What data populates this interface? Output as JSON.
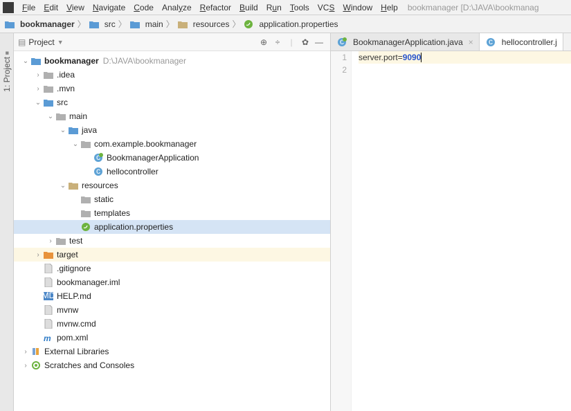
{
  "menu": {
    "items": [
      "File",
      "Edit",
      "View",
      "Navigate",
      "Code",
      "Analyze",
      "Refactor",
      "Build",
      "Run",
      "Tools",
      "VCS",
      "Window",
      "Help"
    ],
    "underlines": [
      0,
      0,
      0,
      0,
      0,
      4,
      0,
      0,
      1,
      0,
      2,
      0,
      0
    ],
    "title_path": "bookmanager [D:\\JAVA\\bookmanag"
  },
  "breadcrumbs": [
    {
      "label": "bookmanager",
      "icon": "folder-blue",
      "bold": true
    },
    {
      "label": "src",
      "icon": "folder-blue"
    },
    {
      "label": "main",
      "icon": "folder-blue"
    },
    {
      "label": "resources",
      "icon": "folder-tan"
    },
    {
      "label": "application.properties",
      "icon": "spring"
    }
  ],
  "side_tab": "1: Project",
  "panel": {
    "title": "Project",
    "tools": [
      "target",
      "expand",
      "divider",
      "gear",
      "hide"
    ]
  },
  "tree": [
    {
      "indent": 0,
      "arrow": "down",
      "icon": "folder-blue",
      "label": "bookmanager",
      "bold": true,
      "hint": "D:\\JAVA\\bookmanager"
    },
    {
      "indent": 1,
      "arrow": "right",
      "icon": "folder-gray",
      "label": ".idea"
    },
    {
      "indent": 1,
      "arrow": "right",
      "icon": "folder-gray",
      "label": ".mvn"
    },
    {
      "indent": 1,
      "arrow": "down",
      "icon": "folder-blue",
      "label": "src"
    },
    {
      "indent": 2,
      "arrow": "down",
      "icon": "folder-gray",
      "label": "main"
    },
    {
      "indent": 3,
      "arrow": "down",
      "icon": "folder-blue",
      "label": "java"
    },
    {
      "indent": 4,
      "arrow": "down",
      "icon": "folder-gray",
      "label": "com.example.bookmanager"
    },
    {
      "indent": 5,
      "arrow": "none",
      "icon": "class-spring",
      "label": "BookmanagerApplication"
    },
    {
      "indent": 5,
      "arrow": "none",
      "icon": "class",
      "label": "hellocontroller"
    },
    {
      "indent": 3,
      "arrow": "down",
      "icon": "folder-tan",
      "label": "resources"
    },
    {
      "indent": 4,
      "arrow": "none",
      "icon": "folder-gray",
      "label": "static"
    },
    {
      "indent": 4,
      "arrow": "none",
      "icon": "folder-gray",
      "label": "templates"
    },
    {
      "indent": 4,
      "arrow": "none",
      "icon": "spring",
      "label": "application.properties",
      "selected": true
    },
    {
      "indent": 2,
      "arrow": "right",
      "icon": "folder-gray",
      "label": "test"
    },
    {
      "indent": 1,
      "arrow": "right",
      "icon": "folder-orange",
      "label": "target",
      "hl": true
    },
    {
      "indent": 1,
      "arrow": "none",
      "icon": "file",
      "label": ".gitignore"
    },
    {
      "indent": 1,
      "arrow": "none",
      "icon": "file",
      "label": "bookmanager.iml"
    },
    {
      "indent": 1,
      "arrow": "none",
      "icon": "md",
      "label": "HELP.md"
    },
    {
      "indent": 1,
      "arrow": "none",
      "icon": "file",
      "label": "mvnw"
    },
    {
      "indent": 1,
      "arrow": "none",
      "icon": "file",
      "label": "mvnw.cmd"
    },
    {
      "indent": 1,
      "arrow": "none",
      "icon": "maven",
      "label": "pom.xml"
    },
    {
      "indent": 0,
      "arrow": "right",
      "icon": "libs",
      "label": "External Libraries"
    },
    {
      "indent": 0,
      "arrow": "right",
      "icon": "scratch",
      "label": "Scratches and Consoles"
    }
  ],
  "tabs": [
    {
      "label": "BookmanagerApplication.java",
      "icon": "class-spring",
      "active": false,
      "closeable": true
    },
    {
      "label": "hellocontroller.j",
      "icon": "class",
      "active": true,
      "closeable": false
    }
  ],
  "editor": {
    "lines": [
      "1",
      "2"
    ],
    "code_key": "server.port=",
    "code_val": "9090"
  }
}
